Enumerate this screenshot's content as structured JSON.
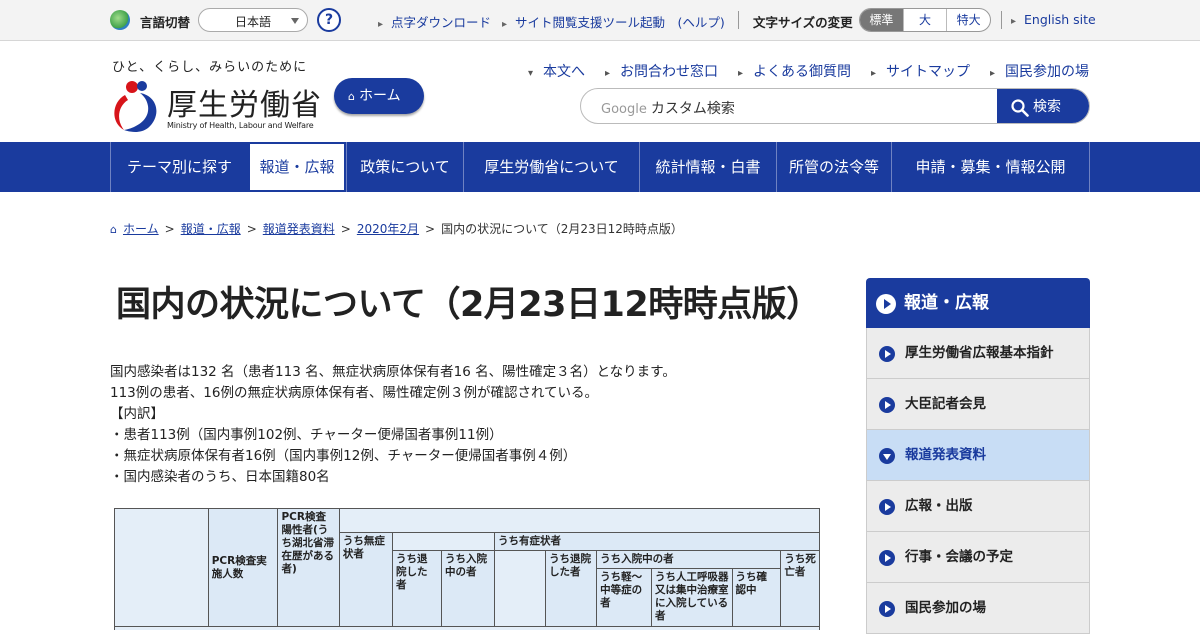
{
  "utility": {
    "lang_label": "言語切替",
    "lang_selected": "日本語",
    "help_glyph": "?",
    "links": [
      "点字ダウンロード",
      "サイト閲覧支援ツール起動　(ヘルプ)"
    ],
    "size_label": "文字サイズの変更",
    "sizes": [
      "標準",
      "大",
      "特大"
    ],
    "english": "English site"
  },
  "header": {
    "tagline": "ひと、くらし、みらいのために",
    "logo_jp": "厚生労働省",
    "logo_en": "Ministry of Health, Labour and Welfare",
    "home_button": "ホーム",
    "nav": [
      "本文へ",
      "お問合わせ窓口",
      "よくある御質問",
      "サイトマップ",
      "国民参加の場"
    ],
    "search_brand": "Google",
    "search_placeholder": "カスタム検索",
    "search_button": "検索"
  },
  "gnav": [
    "テーマ別に探す",
    "報道・広報",
    "政策について",
    "厚生労働省について",
    "統計情報・白書",
    "所管の法令等",
    "申請・募集・情報公開"
  ],
  "breadcrumb": {
    "items": [
      "ホーム",
      "報道・広報",
      "報道発表資料",
      "2020年2月"
    ],
    "current": "国内の状況について（2月23日12時時点版）"
  },
  "main": {
    "title": "国内の状況について（2月23日12時時点版）",
    "paragraphs": [
      "国内感染者は132 名（患者113 名、無症状病原体保有者16 名、陽性確定３名）となります。",
      "113例の患者、16例の無症状病原体保有者、陽性確定例３例が確認されている。",
      "【内訳】",
      "・患者113例（国内事例102例、チャーター便帰国者事例11例）",
      "・無症状病原体保有者16例（国内事例12例、チャーター便帰国者事例４例）",
      "・国内感染者のうち、日本国籍80名"
    ]
  },
  "table": {
    "h_pcr_count": "PCR検査実施人数",
    "h_positive": "PCR検査陽性者(うち湖北省滞在歴がある者)",
    "h_asym": "うち無症状者",
    "h_sym": "うち有症状者",
    "h_asym_discharged": "うち退院した者",
    "h_asym_hosp": "うち入院中の者",
    "h_sym_discharged": "うち退院した者",
    "h_sym_hosp": "うち入院中の者",
    "h_mild": "うち軽〜中等症の者",
    "h_severe": "うち人工呼吸器又は集中治療室に入院している者",
    "h_confirming": "うち確認中",
    "h_dead": "うち死亡者"
  },
  "side": {
    "heading": "報道・広報",
    "items": [
      "厚生労働省広報基本指針",
      "大臣記者会見",
      "報道発表資料",
      "広報・出版",
      "行事・会議の予定",
      "国民参加の場"
    ]
  },
  "colors": {
    "brand": "#1a3b9e",
    "current_bg": "#c8ddf5",
    "table_bg": "#dce9f6"
  }
}
